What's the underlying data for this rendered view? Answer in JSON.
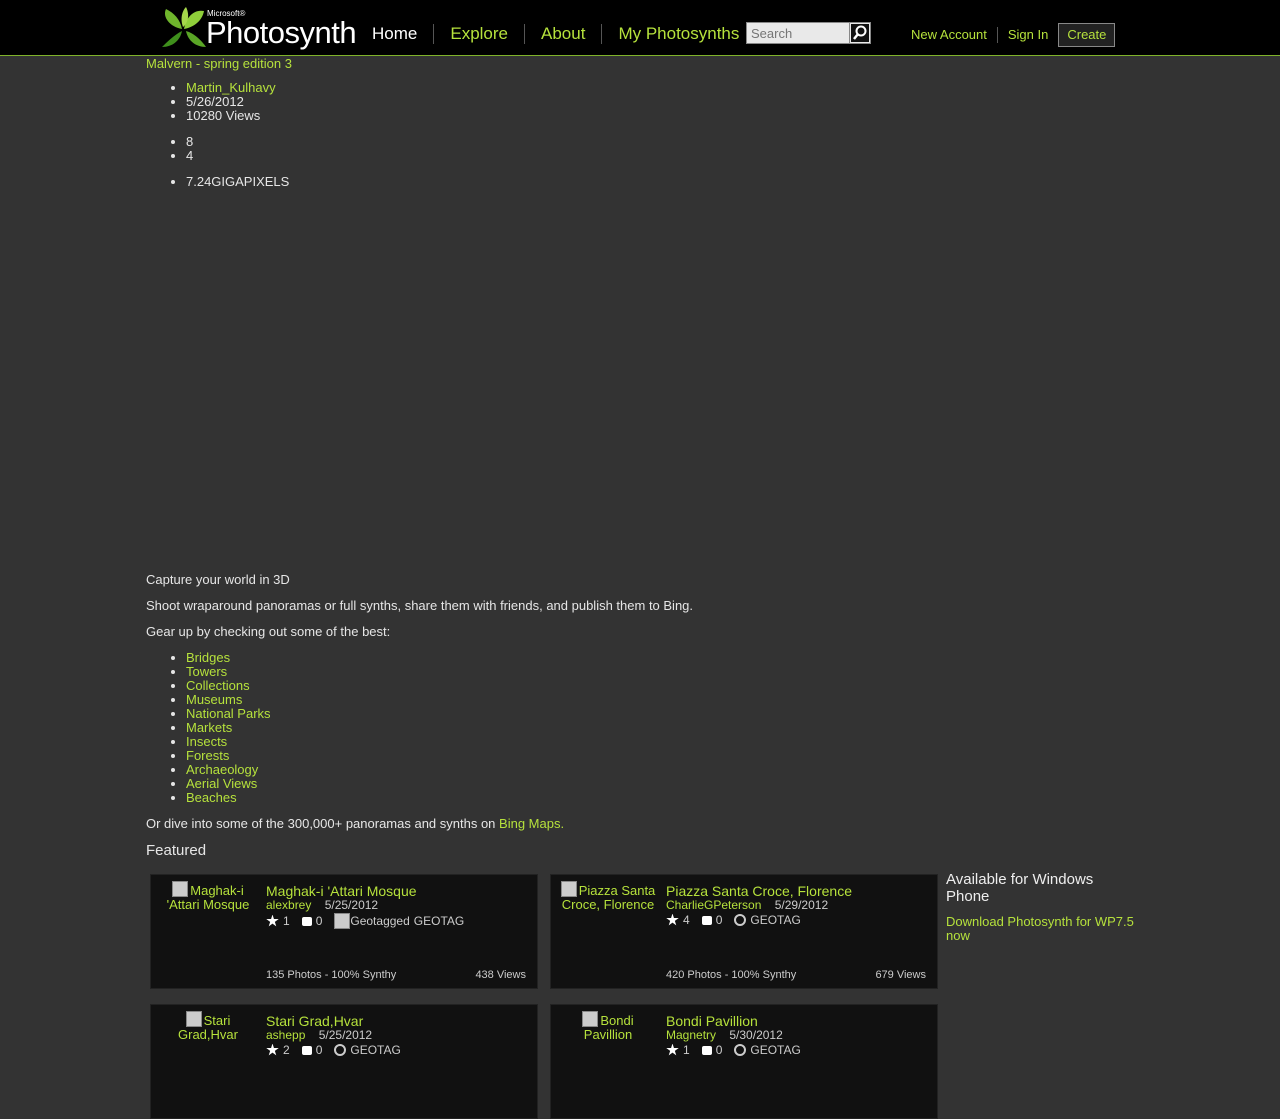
{
  "header": {
    "logo_small": "Microsoft®",
    "logo_text": "Photosynth",
    "nav": [
      "Home",
      "Explore",
      "About",
      "My Photosynths"
    ],
    "search_placeholder": "Search",
    "new_account": "New Account",
    "sign_in": "Sign In",
    "create": "Create"
  },
  "synth": {
    "title": "Malvern - spring edition 3",
    "author": "Martin_Kulhavy",
    "date": "5/26/2012",
    "views": "10280 Views",
    "favorites": "8",
    "comments": "4",
    "size": "7.24GIGAPIXELS"
  },
  "intro": {
    "capture": "Capture your world in 3D",
    "shoot": "Shoot wraparound panoramas or full synths, share them with friends, and publish them to Bing.",
    "gear": "Gear up by checking out some of the best:",
    "categories": [
      "Bridges",
      "Towers",
      "Collections",
      "Museums",
      "National Parks",
      "Markets",
      "Insects",
      "Forests",
      "Archaeology",
      "Aerial Views",
      "Beaches"
    ],
    "dive": "Or dive into some of the 300,000+ panoramas and synths on",
    "bing": "Bing Maps."
  },
  "featured": {
    "heading": "Featured",
    "cards": [
      {
        "img_alt": "Maghak-i 'Attari Mosque",
        "title": "Maghak-i 'Attari Mosque",
        "user": "alexbrey",
        "date": "5/25/2012",
        "favs": "1",
        "comments": "0",
        "geo_alt": "Geotagged",
        "geo": "GEOTAG",
        "photos": "135 Photos - 100% Synthy",
        "views": "438 Views"
      },
      {
        "img_alt": "Piazza Santa Croce, Florence",
        "title": "Piazza Santa Croce, Florence",
        "user": "CharlieGPeterson",
        "date": "5/29/2012",
        "favs": "4",
        "comments": "0",
        "geo": "GEOTAG",
        "photos": "420 Photos - 100% Synthy",
        "views": "679 Views"
      },
      {
        "img_alt": "Stari Grad,Hvar",
        "title": "Stari Grad,Hvar",
        "user": "ashepp",
        "date": "5/25/2012",
        "favs": "2",
        "comments": "0",
        "geo": "GEOTAG"
      },
      {
        "img_alt": "Bondi Pavillion",
        "title": "Bondi Pavillion",
        "user": "Magnetry",
        "date": "5/30/2012",
        "favs": "1",
        "comments": "0",
        "geo": "GEOTAG"
      }
    ]
  },
  "sidebar": {
    "heading": "Available for Windows Phone",
    "download": "Download Photosynth for WP7.5 now"
  }
}
